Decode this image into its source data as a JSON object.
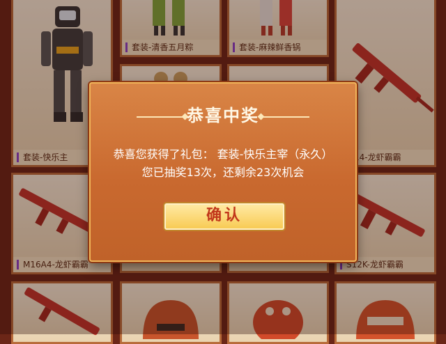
{
  "items": [
    {
      "label": ""
    },
    {
      "label": "套装-清香五月粽"
    },
    {
      "label": "套装-麻辣鲜香锅"
    },
    {
      "label": ""
    },
    {
      "label": "套装-快乐主"
    },
    {
      "label": ""
    },
    {
      "label": ""
    },
    {
      "label": "ni14-龙虾霸霸"
    },
    {
      "label": "M16A4-龙虾霸霸"
    },
    {
      "label": ""
    },
    {
      "label": ""
    },
    {
      "label": "S12K-龙虾霸霸"
    },
    {
      "label": ""
    },
    {
      "label": ""
    },
    {
      "label": ""
    },
    {
      "label": ""
    }
  ],
  "dialog": {
    "title": "恭喜中奖",
    "message_line1": "恭喜您获得了礼包： 套装-快乐主宰（永久）",
    "message_line2": "您已抽奖13次，还剩余23次机会",
    "confirm_label": "确认"
  },
  "colors": {
    "accent": "#c9692f",
    "button": "#f8cb55",
    "button_text": "#c1361a",
    "label_bar": "#8a3fc6"
  }
}
